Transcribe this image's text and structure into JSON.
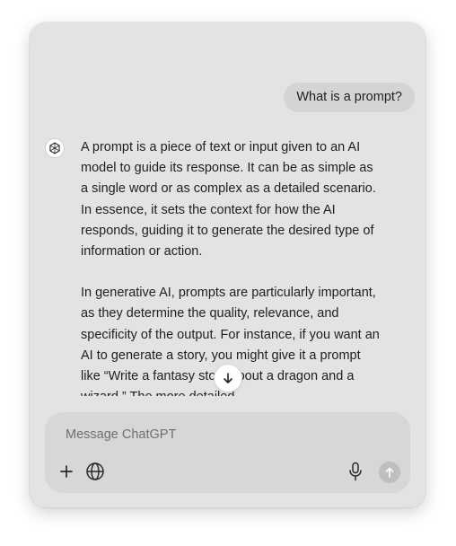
{
  "conversation": {
    "user_message": "What is a prompt?",
    "assistant_paragraphs": [
      "A prompt is a piece of text or input given to an AI model to guide its response. It can be as simple as a single word or as complex as a detailed scenario. In essence, it sets the context for how the AI responds, guiding it to generate the desired type of information or action.",
      "In generative AI, prompts are particularly important, as they determine the quality, relevance, and specificity of the output. For instance, if you want an AI to generate a story, you might give it a prompt like “Write a fantasy story about a dragon and a wizard.” The more detailed"
    ]
  },
  "composer": {
    "placeholder": "Message ChatGPT"
  },
  "icons": {
    "avatar": "chatgpt-logo-icon",
    "scroll": "arrow-down-icon",
    "attach": "plus-icon",
    "search": "globe-icon",
    "voice": "microphone-icon",
    "send": "arrow-up-icon"
  },
  "colors": {
    "window_bg": "#e3e3e3",
    "bubble_bg": "#d4d4d4",
    "composer_bg": "#d7d7d7",
    "send_disabled": "#bfbfbf"
  }
}
